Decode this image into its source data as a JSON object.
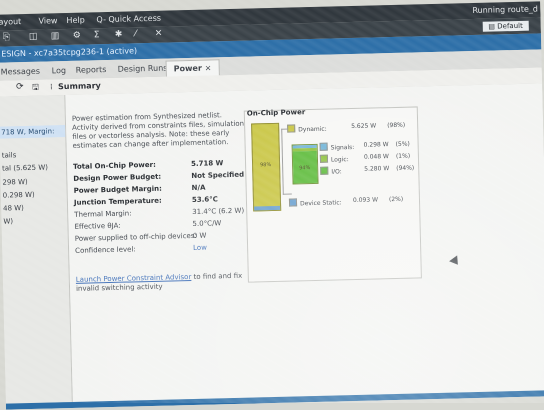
{
  "menu": {
    "layout": "ayout",
    "view": "View",
    "help": "Help",
    "quick_access": "Q- Quick Access",
    "status": "Running route_d"
  },
  "toolbar": {
    "default_layout": "Default"
  },
  "design": {
    "title": "ESIGN - xc7a35tcpg236-1 (active)"
  },
  "tabs": [
    "Messages",
    "Log",
    "Reports",
    "Design Runs",
    "Power"
  ],
  "section": {
    "summary": "Summary"
  },
  "left_panel": {
    "selected": "718 W, Margin:",
    "items": [
      "tails",
      "tal (5.625 W)",
      "298 W)",
      "0.298 W)",
      "48 W)",
      "W)"
    ]
  },
  "summary": {
    "description": "Power estimation from Synthesized netlist. Activity derived from constraints files, simulation files or vectorless analysis. Note: these early estimates can change after implementation.",
    "rows": [
      {
        "label": "Total On-Chip Power:",
        "value": "5.718 W"
      },
      {
        "label": "Design Power Budget:",
        "value": "Not Specified"
      },
      {
        "label": "Power Budget Margin:",
        "value": "N/A"
      },
      {
        "label": "Junction Temperature:",
        "value": "53.6°C"
      },
      {
        "label": "Thermal Margin:",
        "value": "31.4°C (6.2 W)"
      },
      {
        "label": "Effective θJA:",
        "value": "5.0°C/W"
      },
      {
        "label": "Power supplied to off-chip devices:",
        "value": "0 W"
      },
      {
        "label": "Confidence level:",
        "value": "Low"
      }
    ],
    "launch_link": "Launch Power Constraint Advisor",
    "launch_rest": "to find and fix invalid switching activity"
  },
  "on_chip": {
    "title": "On-Chip Power",
    "bar_pct": "98%",
    "sub_pct": "94%",
    "dynamic": {
      "label": "Dynamic:",
      "watts": "5.625 W",
      "pct": "(98%)"
    },
    "signals": {
      "label": "Signals:",
      "watts": "0.298 W",
      "pct": "(5%)"
    },
    "logic": {
      "label": "Logic:",
      "watts": "0.048 W",
      "pct": "(1%)"
    },
    "io": {
      "label": "I/O:",
      "watts": "5.280 W",
      "pct": "(94%)"
    },
    "device_static": {
      "label": "Device Static:",
      "watts": "0.093 W",
      "pct": "(2%)"
    }
  },
  "colors": {
    "dynamic": "#c9c644",
    "signals": "#72b5d8",
    "logic": "#8fc23f",
    "io": "#5dbb3a",
    "static": "#6aa0cf"
  }
}
